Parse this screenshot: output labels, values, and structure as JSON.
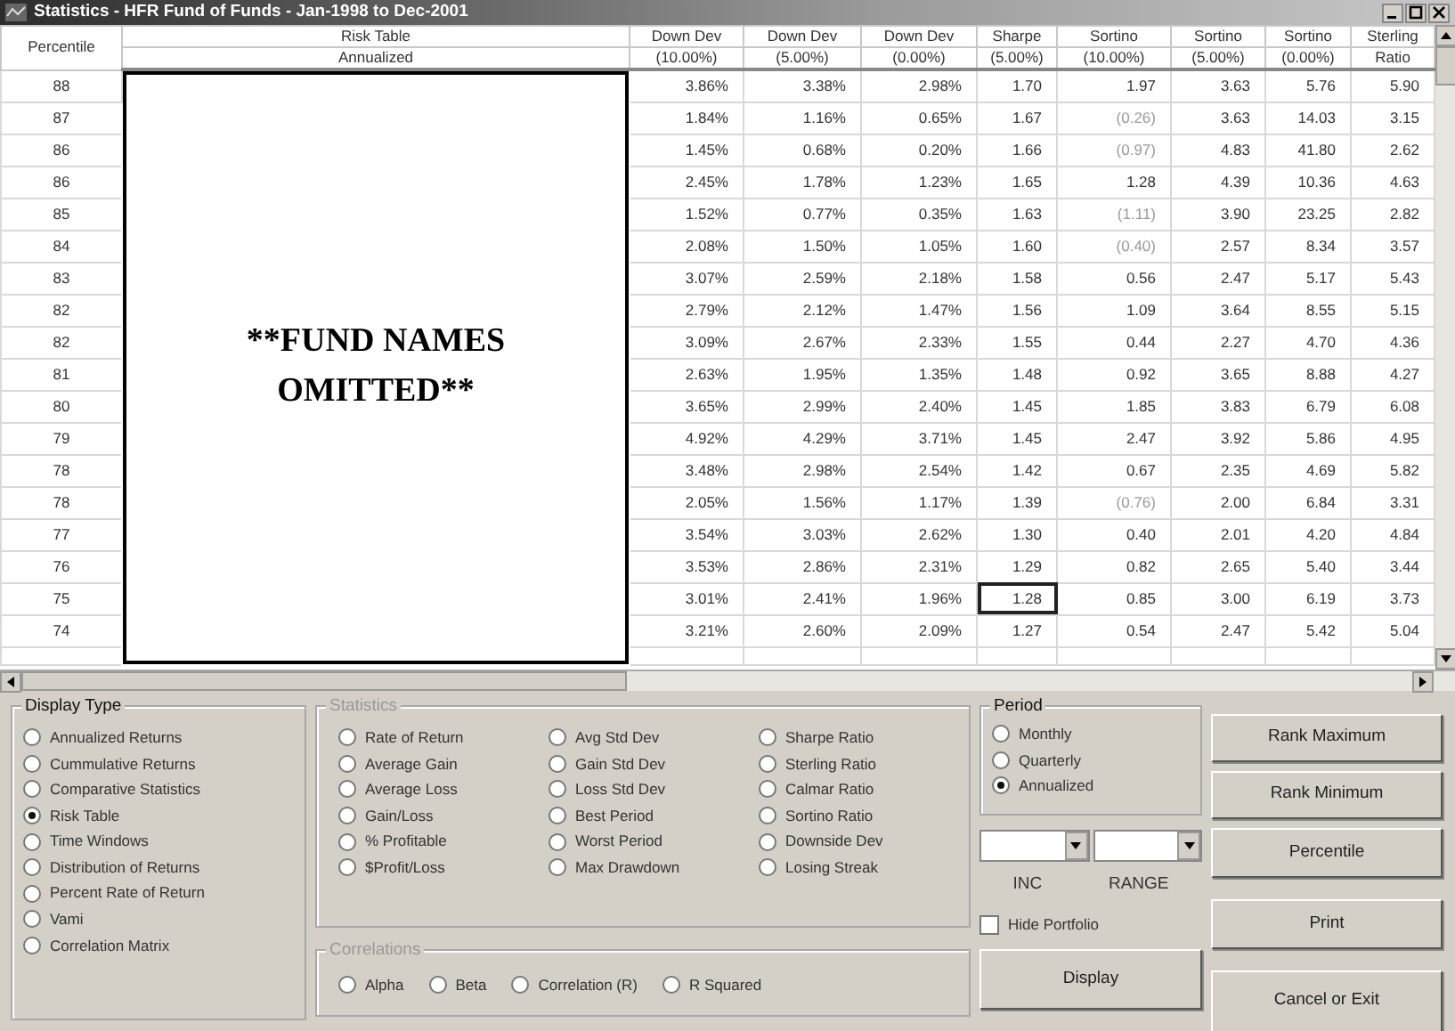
{
  "window": {
    "title": "Statistics - HFR Fund of Funds - Jan-1998 to Dec-2001"
  },
  "table": {
    "columns": [
      {
        "line1": "Percentile"
      },
      {
        "line1": "Risk Table",
        "line2": "Annualized"
      },
      {
        "line1": "Down Dev",
        "line2": "(10.00%)"
      },
      {
        "line1": "Down Dev",
        "line2": "(5.00%)"
      },
      {
        "line1": "Down Dev",
        "line2": "(0.00%)"
      },
      {
        "line1": "Sharpe",
        "line2": "(5.00%)"
      },
      {
        "line1": "Sortino",
        "line2": "(10.00%)"
      },
      {
        "line1": "Sortino",
        "line2": "(5.00%)"
      },
      {
        "line1": "Sortino",
        "line2": "(0.00%)"
      },
      {
        "line1": "Sterling",
        "line2": "Ratio"
      }
    ],
    "overlay_text": "**FUND NAMES OMITTED**",
    "rows": [
      {
        "percentile": "88",
        "values": [
          "3.86%",
          "3.38%",
          "2.98%",
          "1.70",
          "1.97",
          "3.63",
          "5.76",
          "5.90"
        ],
        "sortino_greyed": false,
        "sharpe_focused": false
      },
      {
        "percentile": "87",
        "values": [
          "1.84%",
          "1.16%",
          "0.65%",
          "1.67",
          "(0.26)",
          "3.63",
          "14.03",
          "3.15"
        ],
        "sortino_greyed": true,
        "sharpe_focused": false
      },
      {
        "percentile": "86",
        "values": [
          "1.45%",
          "0.68%",
          "0.20%",
          "1.66",
          "(0.97)",
          "4.83",
          "41.80",
          "2.62"
        ],
        "sortino_greyed": true,
        "sharpe_focused": false
      },
      {
        "percentile": "86",
        "values": [
          "2.45%",
          "1.78%",
          "1.23%",
          "1.65",
          "1.28",
          "4.39",
          "10.36",
          "4.63"
        ],
        "sortino_greyed": false,
        "sharpe_focused": false
      },
      {
        "percentile": "85",
        "values": [
          "1.52%",
          "0.77%",
          "0.35%",
          "1.63",
          "(1.11)",
          "3.90",
          "23.25",
          "2.82"
        ],
        "sortino_greyed": true,
        "sharpe_focused": false
      },
      {
        "percentile": "84",
        "values": [
          "2.08%",
          "1.50%",
          "1.05%",
          "1.60",
          "(0.40)",
          "2.57",
          "8.34",
          "3.57"
        ],
        "sortino_greyed": true,
        "sharpe_focused": false
      },
      {
        "percentile": "83",
        "values": [
          "3.07%",
          "2.59%",
          "2.18%",
          "1.58",
          "0.56",
          "2.47",
          "5.17",
          "5.43"
        ],
        "sortino_greyed": false,
        "sharpe_focused": false
      },
      {
        "percentile": "82",
        "values": [
          "2.79%",
          "2.12%",
          "1.47%",
          "1.56",
          "1.09",
          "3.64",
          "8.55",
          "5.15"
        ],
        "sortino_greyed": false,
        "sharpe_focused": false
      },
      {
        "percentile": "82",
        "values": [
          "3.09%",
          "2.67%",
          "2.33%",
          "1.55",
          "0.44",
          "2.27",
          "4.70",
          "4.36"
        ],
        "sortino_greyed": false,
        "sharpe_focused": false
      },
      {
        "percentile": "81",
        "values": [
          "2.63%",
          "1.95%",
          "1.35%",
          "1.48",
          "0.92",
          "3.65",
          "8.88",
          "4.27"
        ],
        "sortino_greyed": false,
        "sharpe_focused": false
      },
      {
        "percentile": "80",
        "values": [
          "3.65%",
          "2.99%",
          "2.40%",
          "1.45",
          "1.85",
          "3.83",
          "6.79",
          "6.08"
        ],
        "sortino_greyed": false,
        "sharpe_focused": false
      },
      {
        "percentile": "79",
        "values": [
          "4.92%",
          "4.29%",
          "3.71%",
          "1.45",
          "2.47",
          "3.92",
          "5.86",
          "4.95"
        ],
        "sortino_greyed": false,
        "sharpe_focused": false
      },
      {
        "percentile": "78",
        "values": [
          "3.48%",
          "2.98%",
          "2.54%",
          "1.42",
          "0.67",
          "2.35",
          "4.69",
          "5.82"
        ],
        "sortino_greyed": false,
        "sharpe_focused": false
      },
      {
        "percentile": "78",
        "values": [
          "2.05%",
          "1.56%",
          "1.17%",
          "1.39",
          "(0.76)",
          "2.00",
          "6.84",
          "3.31"
        ],
        "sortino_greyed": true,
        "sharpe_focused": false
      },
      {
        "percentile": "77",
        "values": [
          "3.54%",
          "3.03%",
          "2.62%",
          "1.30",
          "0.40",
          "2.01",
          "4.20",
          "4.84"
        ],
        "sortino_greyed": false,
        "sharpe_focused": false
      },
      {
        "percentile": "76",
        "values": [
          "3.53%",
          "2.86%",
          "2.31%",
          "1.29",
          "0.82",
          "2.65",
          "5.40",
          "3.44"
        ],
        "sortino_greyed": false,
        "sharpe_focused": false
      },
      {
        "percentile": "75",
        "values": [
          "3.01%",
          "2.41%",
          "1.96%",
          "1.28",
          "0.85",
          "3.00",
          "6.19",
          "3.73"
        ],
        "sortino_greyed": false,
        "sharpe_focused": true
      },
      {
        "percentile": "74",
        "values": [
          "3.21%",
          "2.60%",
          "2.09%",
          "1.27",
          "0.54",
          "2.47",
          "5.42",
          "5.04"
        ],
        "sortino_greyed": false,
        "sharpe_focused": false
      }
    ]
  },
  "display_type": {
    "title": "Display Type",
    "options": [
      {
        "label": "Annualized Returns",
        "selected": false
      },
      {
        "label": "Cummulative Returns",
        "selected": false
      },
      {
        "label": "Comparative Statistics",
        "selected": false
      },
      {
        "label": "Risk Table",
        "selected": true
      },
      {
        "label": "Time Windows",
        "selected": false
      },
      {
        "label": "Distribution of Returns",
        "selected": false
      },
      {
        "label": "Percent Rate of Return",
        "selected": false
      },
      {
        "label": "Vami",
        "selected": false
      },
      {
        "label": "Correlation Matrix",
        "selected": false
      }
    ]
  },
  "statistics": {
    "title": "Statistics",
    "disabled": true,
    "columns": [
      {
        "options": [
          {
            "label": "Rate of Return",
            "selected": false
          },
          {
            "label": "Average Gain",
            "selected": false
          },
          {
            "label": "Average Loss",
            "selected": false
          },
          {
            "label": "Gain/Loss",
            "selected": false
          },
          {
            "label": "% Profitable",
            "selected": false
          },
          {
            "label": "$Profit/Loss",
            "selected": false
          }
        ]
      },
      {
        "options": [
          {
            "label": "Avg Std Dev",
            "selected": false
          },
          {
            "label": "Gain Std Dev",
            "selected": false
          },
          {
            "label": "Loss Std Dev",
            "selected": false
          },
          {
            "label": "Best Period",
            "selected": false
          },
          {
            "label": "Worst Period",
            "selected": false
          },
          {
            "label": "Max Drawdown",
            "selected": false
          }
        ]
      },
      {
        "options": [
          {
            "label": "Sharpe Ratio",
            "selected": false
          },
          {
            "label": "Sterling Ratio",
            "selected": false
          },
          {
            "label": "Calmar Ratio",
            "selected": false
          },
          {
            "label": "Sortino Ratio",
            "selected": false
          },
          {
            "label": "Downside Dev",
            "selected": false
          },
          {
            "label": "Losing Streak",
            "selected": false
          }
        ]
      }
    ]
  },
  "correlations": {
    "title": "Correlations",
    "disabled": true,
    "options": [
      {
        "label": "Alpha",
        "selected": false
      },
      {
        "label": "Beta",
        "selected": false
      },
      {
        "label": "Correlation (R)",
        "selected": false
      },
      {
        "label": "R Squared",
        "selected": false
      }
    ]
  },
  "period": {
    "title": "Period",
    "options": [
      {
        "label": "Monthly",
        "selected": false
      },
      {
        "label": "Quarterly",
        "selected": false
      },
      {
        "label": "Annualized",
        "selected": true
      }
    ]
  },
  "range": {
    "labels": [
      "INC",
      "RANGE"
    ]
  },
  "hide_portfolio": {
    "label": "Hide Portfolio",
    "checked": false
  },
  "display_button": {
    "label": "Display"
  },
  "buttons": [
    {
      "label": "Rank Maximum"
    },
    {
      "label": "Rank Minimum"
    },
    {
      "label": "Percentile"
    },
    {
      "label": "Print"
    },
    {
      "label": "Cancel or Exit"
    }
  ]
}
